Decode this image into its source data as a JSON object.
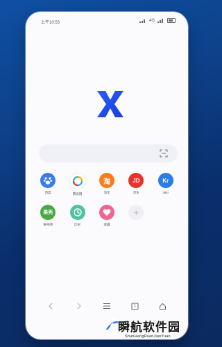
{
  "status": {
    "time": "上午10:53",
    "network": "4G"
  },
  "search": {
    "placeholder": ""
  },
  "apps": [
    {
      "label": "百度",
      "icon": "baidu-paw-icon",
      "color": "#3a7bef"
    },
    {
      "label": "腾讯网",
      "icon": "tencent-news-icon",
      "color": "#2fa6e8"
    },
    {
      "label": "淘宝",
      "icon": "taobao-icon",
      "color": "#ff7a1a",
      "glyph": "淘"
    },
    {
      "label": "京东",
      "icon": "jd-icon",
      "color": "#e8322a",
      "glyph": "JD"
    },
    {
      "label": "36kr",
      "icon": "36kr-icon",
      "color": "#2a7de9",
      "glyph": "Kr"
    },
    {
      "label": "果壳网",
      "icon": "guokr-icon",
      "color": "#4aa646",
      "glyph": "果壳"
    },
    {
      "label": "历史",
      "icon": "clock-icon",
      "color": "#4fc2a2"
    },
    {
      "label": "收藏",
      "icon": "heart-icon",
      "color": "#f0668e"
    },
    {
      "label": "",
      "icon": "add-icon",
      "color": "#eef0f5"
    }
  ],
  "nav": {
    "back": "back-icon",
    "forward": "forward-icon",
    "menu": "menu-icon",
    "tabs": "tabs-icon",
    "tabs_count": "1",
    "home": "home-icon"
  },
  "watermark": {
    "title": "瞬航软件园",
    "subtitle": "ShunHangRuanJianYuan"
  }
}
